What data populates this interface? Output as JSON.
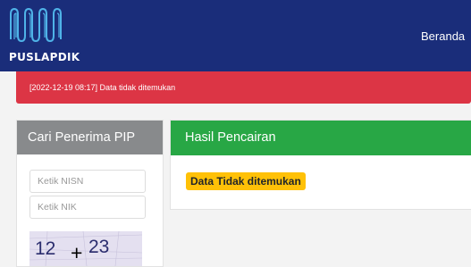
{
  "brand": {
    "name": "PUSLAPDIK"
  },
  "nav": {
    "home": "Beranda"
  },
  "alert": {
    "message": "[2022-12-19 08:17] Data tidak ditemukan"
  },
  "search": {
    "title": "Cari Penerima PIP",
    "nisn_placeholder": "Ketik NISN",
    "nik_placeholder": "Ketik NIK",
    "captcha": {
      "left": "12",
      "op": "+",
      "right": "23"
    }
  },
  "result": {
    "title": "Hasil Pencairan",
    "status": "Data Tidak ditemukan"
  },
  "colors": {
    "navbar": "#1a2d7a",
    "alert": "#dc3545",
    "search_header": "#888a8c",
    "result_header": "#28a745",
    "badge": "#ffc107"
  }
}
